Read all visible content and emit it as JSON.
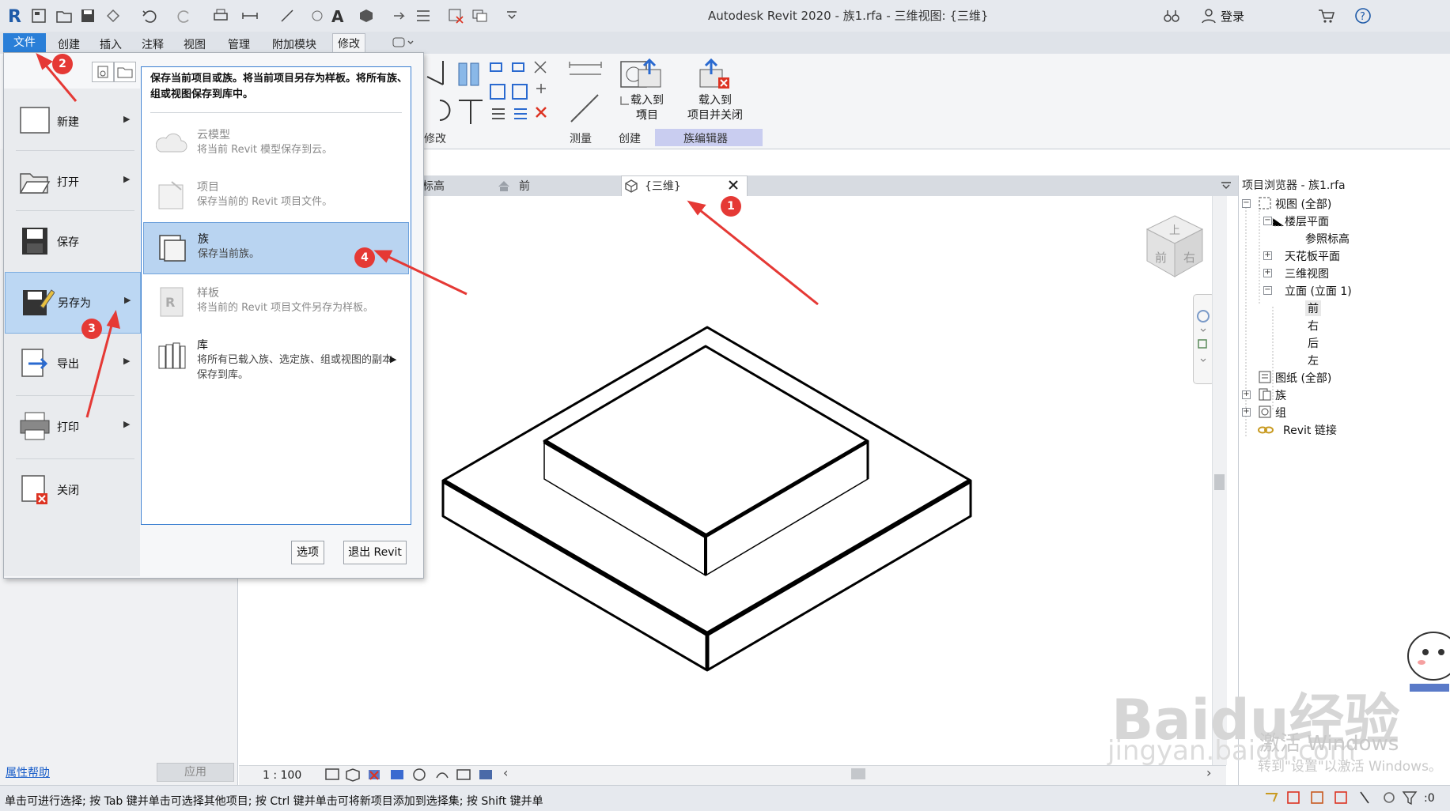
{
  "window": {
    "title": "Autodesk Revit 2020 - 族1.rfa - 三维视图: {三维}"
  },
  "account": {
    "login_label": "登录"
  },
  "ribbon": {
    "tabs": [
      {
        "label": "文件"
      },
      {
        "label": "创建"
      },
      {
        "label": "插入"
      },
      {
        "label": "注释"
      },
      {
        "label": "视图"
      },
      {
        "label": "管理"
      },
      {
        "label": "附加模块"
      },
      {
        "label": "修改"
      }
    ],
    "panels": {
      "modify": "修改",
      "measure": "测量",
      "create": "创建",
      "family_editor": "族编辑器"
    },
    "load_into_project": "载入到\n项目",
    "load_into_project_close": "载入到\n项目并关闭"
  },
  "view_tabs": [
    {
      "label": "标高"
    },
    {
      "label": "前"
    },
    {
      "label": "{三维}"
    }
  ],
  "properties": {
    "help_link": "属性帮助",
    "apply_button": "应用"
  },
  "view_control": {
    "scale": "1 : 100"
  },
  "project_browser": {
    "title": "项目浏览器 - 族1.rfa",
    "items": [
      {
        "label": "视图 (全部)"
      },
      {
        "label": "楼层平面"
      },
      {
        "label": "参照标高"
      },
      {
        "label": "天花板平面"
      },
      {
        "label": "三维视图"
      },
      {
        "label": "立面 (立面 1)"
      },
      {
        "label": "前"
      },
      {
        "label": "右"
      },
      {
        "label": "后"
      },
      {
        "label": "左"
      },
      {
        "label": "图纸 (全部)"
      },
      {
        "label": "族"
      },
      {
        "label": "组"
      },
      {
        "label": "Revit 链接"
      }
    ]
  },
  "app_menu": {
    "items": [
      {
        "label": "新建"
      },
      {
        "label": "打开"
      },
      {
        "label": "保存"
      },
      {
        "label": "另存为"
      },
      {
        "label": "导出"
      },
      {
        "label": "打印"
      },
      {
        "label": "关闭"
      }
    ],
    "save_as": {
      "header": "保存当前项目或族。将当前项目另存为样板。将所有族、组或视图保存到库中。",
      "options": [
        {
          "title": "云模型",
          "desc": "将当前 Revit 模型保存到云。"
        },
        {
          "title": "项目",
          "desc": "保存当前的 Revit 项目文件。"
        },
        {
          "title": "族",
          "desc": "保存当前族。"
        },
        {
          "title": "样板",
          "desc": "将当前的 Revit 项目文件另存为样板。"
        },
        {
          "title": "库",
          "desc": "将所有已载入族、选定族、组或视图的副本保存到库。"
        }
      ]
    },
    "options_button": "选项",
    "exit_button": "退出 Revit"
  },
  "viewcube": {
    "face_front": "前",
    "face_right": "右",
    "face_top": "上"
  },
  "status": {
    "text": "单击可进行选择; 按 Tab 键并单击可选择其他项目; 按 Ctrl 键并单击可将新项目添加到选择集; 按 Shift 键并单",
    "filter_count": ":0"
  },
  "annotations": [
    "1",
    "2",
    "3",
    "4"
  ],
  "watermark": {
    "activate": "激活 Windows",
    "activate_hint": "转到\"设置\"以激活 Windows。",
    "brand": "Baidu经验",
    "url": "jingyan.baidu.com"
  },
  "colors": {
    "file_tab": "#2a7fd8",
    "selection": "#bcd7f3",
    "annotation": "#e53935"
  }
}
